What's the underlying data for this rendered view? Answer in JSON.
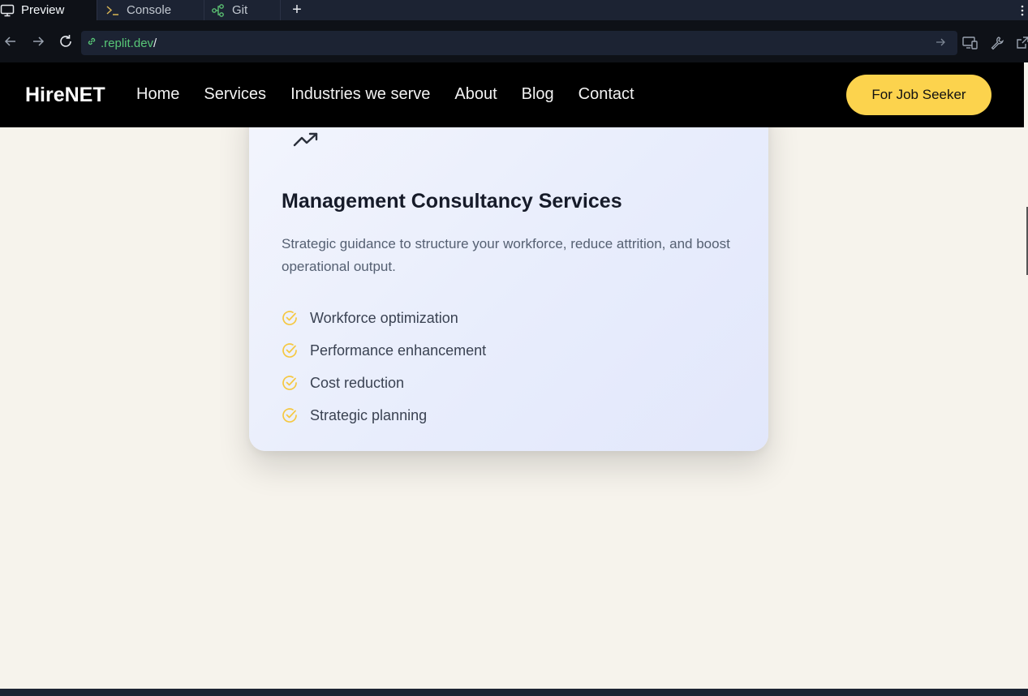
{
  "browser": {
    "tabs": [
      {
        "label": "Preview",
        "icon": "monitor-icon",
        "active": true
      },
      {
        "label": "Console",
        "icon": "terminal-icon",
        "active": false
      },
      {
        "label": "Git",
        "icon": "git-branch-icon",
        "active": false
      }
    ],
    "add_tab_label": "+",
    "url_domain": ".replit.dev",
    "url_path": "/"
  },
  "site": {
    "brand": "HireNET",
    "nav": [
      {
        "label": "Home"
      },
      {
        "label": "Services"
      },
      {
        "label": "Industries we serve"
      },
      {
        "label": "About"
      },
      {
        "label": "Blog"
      },
      {
        "label": "Contact"
      }
    ],
    "cta_label": "For Job Seeker"
  },
  "card": {
    "icon": "trending-up-icon",
    "title": "Management Consultancy Services",
    "description": "Strategic guidance to structure your workforce, reduce attrition, and boost operational output.",
    "features": [
      {
        "label": "Workforce optimization"
      },
      {
        "label": "Performance enhancement"
      },
      {
        "label": "Cost reduction"
      },
      {
        "label": "Strategic planning"
      }
    ]
  },
  "colors": {
    "accent": "#fcd34d",
    "header_bg": "#000000",
    "page_bg": "#f6f3ec",
    "url_green": "#58c777"
  }
}
